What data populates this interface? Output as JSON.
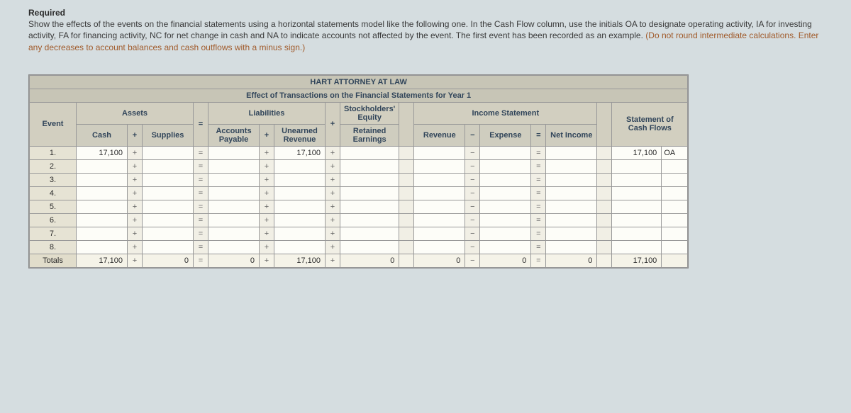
{
  "required": {
    "title": "Required",
    "line1": "Show the effects of the events on the financial statements using a horizontal statements model like the following one. In the Cash Flow column, use the initials OA to designate operating activity, IA for investing activity, FA for financing activity, NC for net change in cash and NA to indicate accounts not affected by the event. The first event has been recorded as an example. ",
    "line2_orange": "(Do not round intermediate calculations. Enter any decreases to account balances and cash outflows with a minus sign.)"
  },
  "table": {
    "title": "HART ATTORNEY AT LAW",
    "subtitle": "Effect of Transactions on the Financial Statements for Year 1",
    "header1": {
      "event": "Event",
      "assets": "Assets",
      "liabilities": "Liabilities",
      "stockholders": "Stockholders' Equity",
      "income": "Income Statement",
      "cashflows": "Statement of Cash Flows"
    },
    "header2": {
      "cash": "Cash",
      "supplies": "Supplies",
      "accounts_payable": "Accounts Payable",
      "unearned_revenue": "Unearned Revenue",
      "retained_earnings": "Retained Earnings",
      "revenue": "Revenue",
      "expense": "Expense",
      "net_income": "Net Income"
    },
    "ops": {
      "plus": "+",
      "minus": "−",
      "eq": "="
    },
    "rows": [
      {
        "event": "1.",
        "cash": "17,100",
        "supplies": "",
        "ap": "",
        "ur": "17,100",
        "re": "",
        "rev": "",
        "exp": "",
        "ni": "",
        "cf": "17,100",
        "cftype": "OA"
      },
      {
        "event": "2.",
        "cash": "",
        "supplies": "",
        "ap": "",
        "ur": "",
        "re": "",
        "rev": "",
        "exp": "",
        "ni": "",
        "cf": "",
        "cftype": ""
      },
      {
        "event": "3.",
        "cash": "",
        "supplies": "",
        "ap": "",
        "ur": "",
        "re": "",
        "rev": "",
        "exp": "",
        "ni": "",
        "cf": "",
        "cftype": ""
      },
      {
        "event": "4.",
        "cash": "",
        "supplies": "",
        "ap": "",
        "ur": "",
        "re": "",
        "rev": "",
        "exp": "",
        "ni": "",
        "cf": "",
        "cftype": ""
      },
      {
        "event": "5.",
        "cash": "",
        "supplies": "",
        "ap": "",
        "ur": "",
        "re": "",
        "rev": "",
        "exp": "",
        "ni": "",
        "cf": "",
        "cftype": ""
      },
      {
        "event": "6.",
        "cash": "",
        "supplies": "",
        "ap": "",
        "ur": "",
        "re": "",
        "rev": "",
        "exp": "",
        "ni": "",
        "cf": "",
        "cftype": ""
      },
      {
        "event": "7.",
        "cash": "",
        "supplies": "",
        "ap": "",
        "ur": "",
        "re": "",
        "rev": "",
        "exp": "",
        "ni": "",
        "cf": "",
        "cftype": ""
      },
      {
        "event": "8.",
        "cash": "",
        "supplies": "",
        "ap": "",
        "ur": "",
        "re": "",
        "rev": "",
        "exp": "",
        "ni": "",
        "cf": "",
        "cftype": ""
      }
    ],
    "totals": {
      "label": "Totals",
      "cash": "17,100",
      "supplies": "0",
      "ap": "0",
      "ur": "17,100",
      "re": "0",
      "rev": "0",
      "exp": "0",
      "ni": "0",
      "cf": "17,100",
      "cftype": ""
    }
  }
}
